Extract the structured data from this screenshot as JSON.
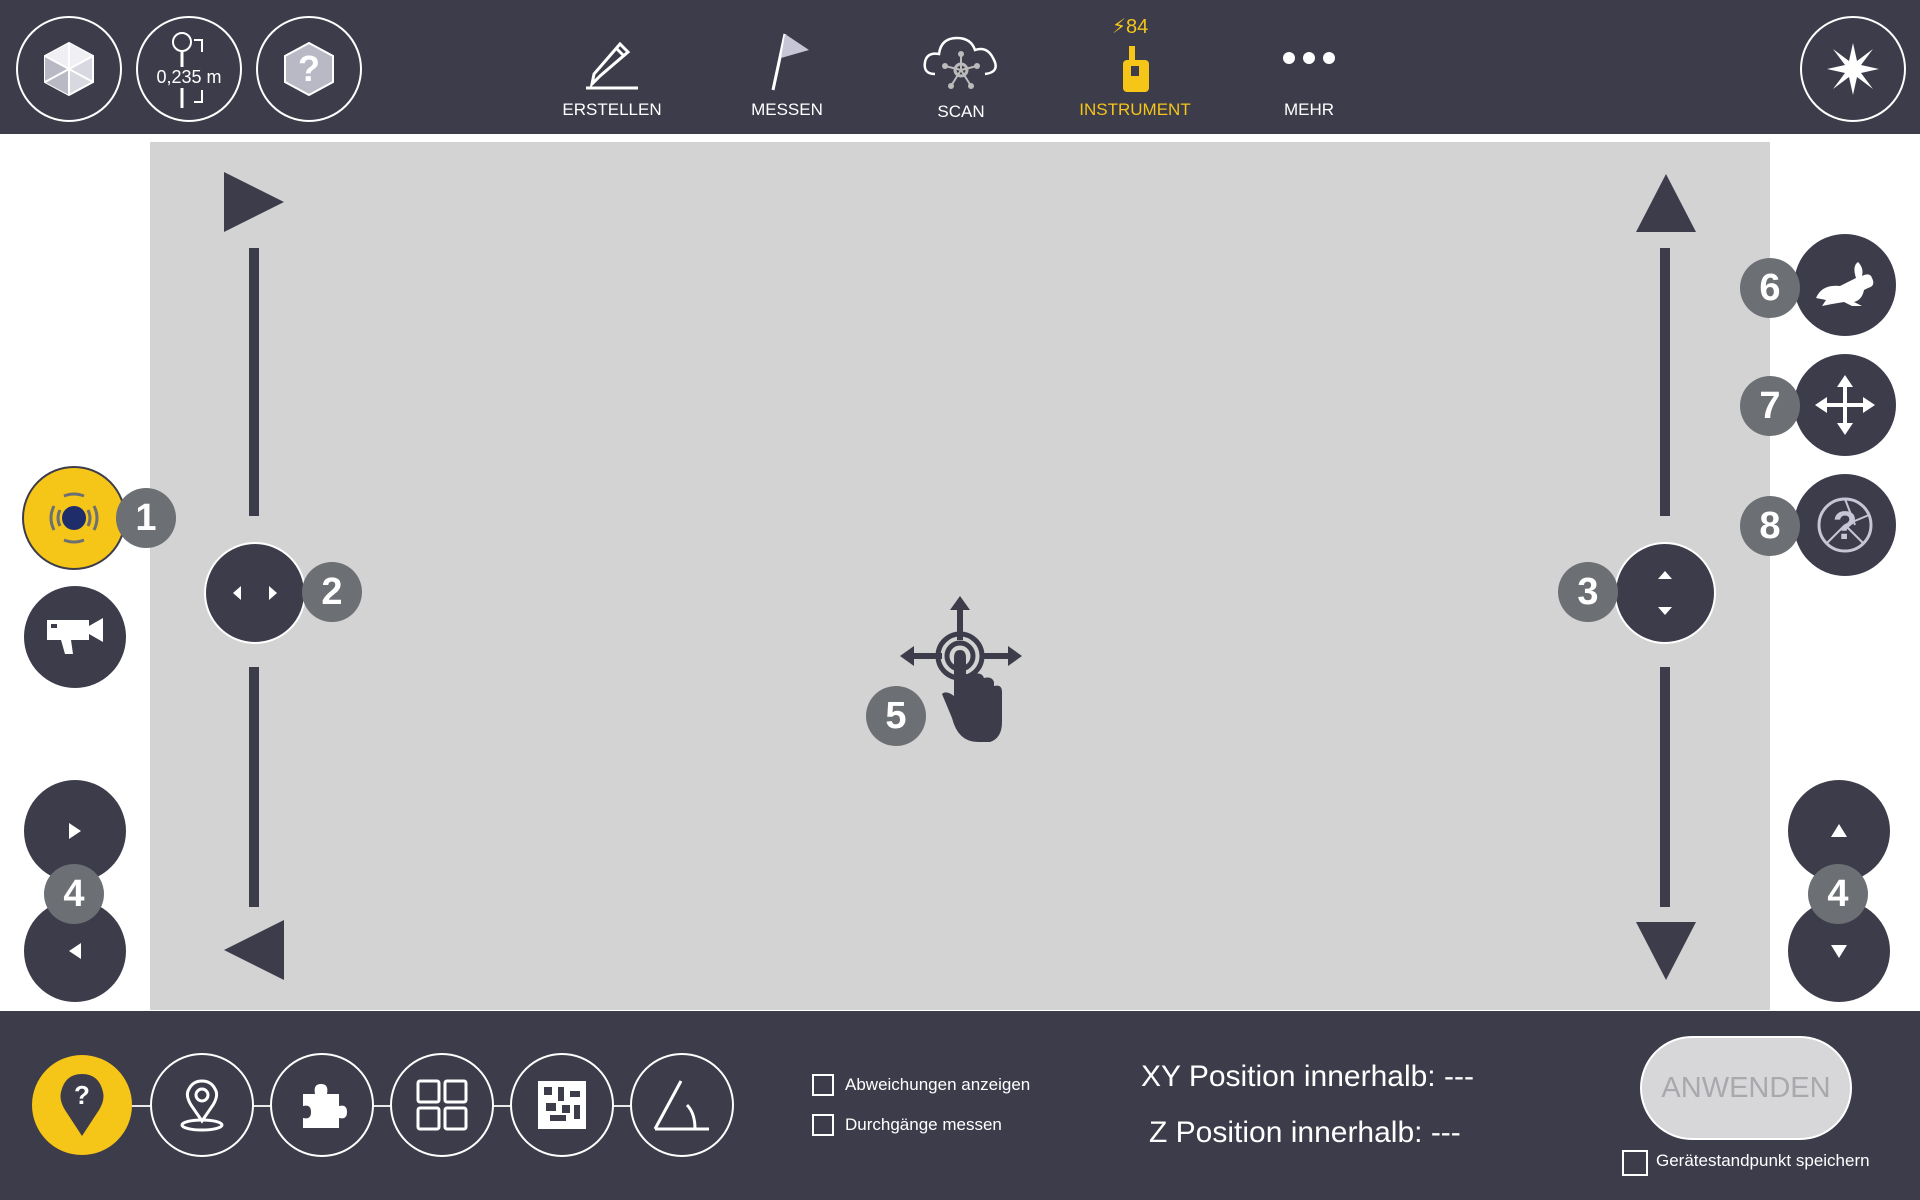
{
  "toolbar": {
    "scale_value": "0,235 m",
    "nav": [
      {
        "label": "ERSTELLEN",
        "icon": "pencil-icon"
      },
      {
        "label": "MESSEN",
        "icon": "flag-icon"
      },
      {
        "label": "SCAN",
        "icon": "cloud-scan-icon"
      },
      {
        "label": "INSTRUMENT",
        "icon": "instrument-icon",
        "active": true,
        "battery": "84"
      },
      {
        "label": "MEHR",
        "icon": "more-icon"
      }
    ]
  },
  "badges": {
    "b1": "1",
    "b2": "2",
    "b3": "3",
    "b4_left": "4",
    "b4_right": "4",
    "b5": "5",
    "b6": "6",
    "b7": "7",
    "b8": "8"
  },
  "bottom": {
    "checkbox_deviations": "Abweichungen anzeigen",
    "checkbox_passes": "Durchgänge messen",
    "xy_position": "XY Position innerhalb:  ---",
    "z_position": "Z Position innerhalb:  ---",
    "apply_label": "ANWENDEN",
    "save_station_label": "Gerätestandpunkt speichern"
  },
  "colors": {
    "bar_bg": "#3d3c4b",
    "accent": "#f5c518",
    "viewport": "#d3d3d3",
    "badge": "#6c6f73"
  }
}
